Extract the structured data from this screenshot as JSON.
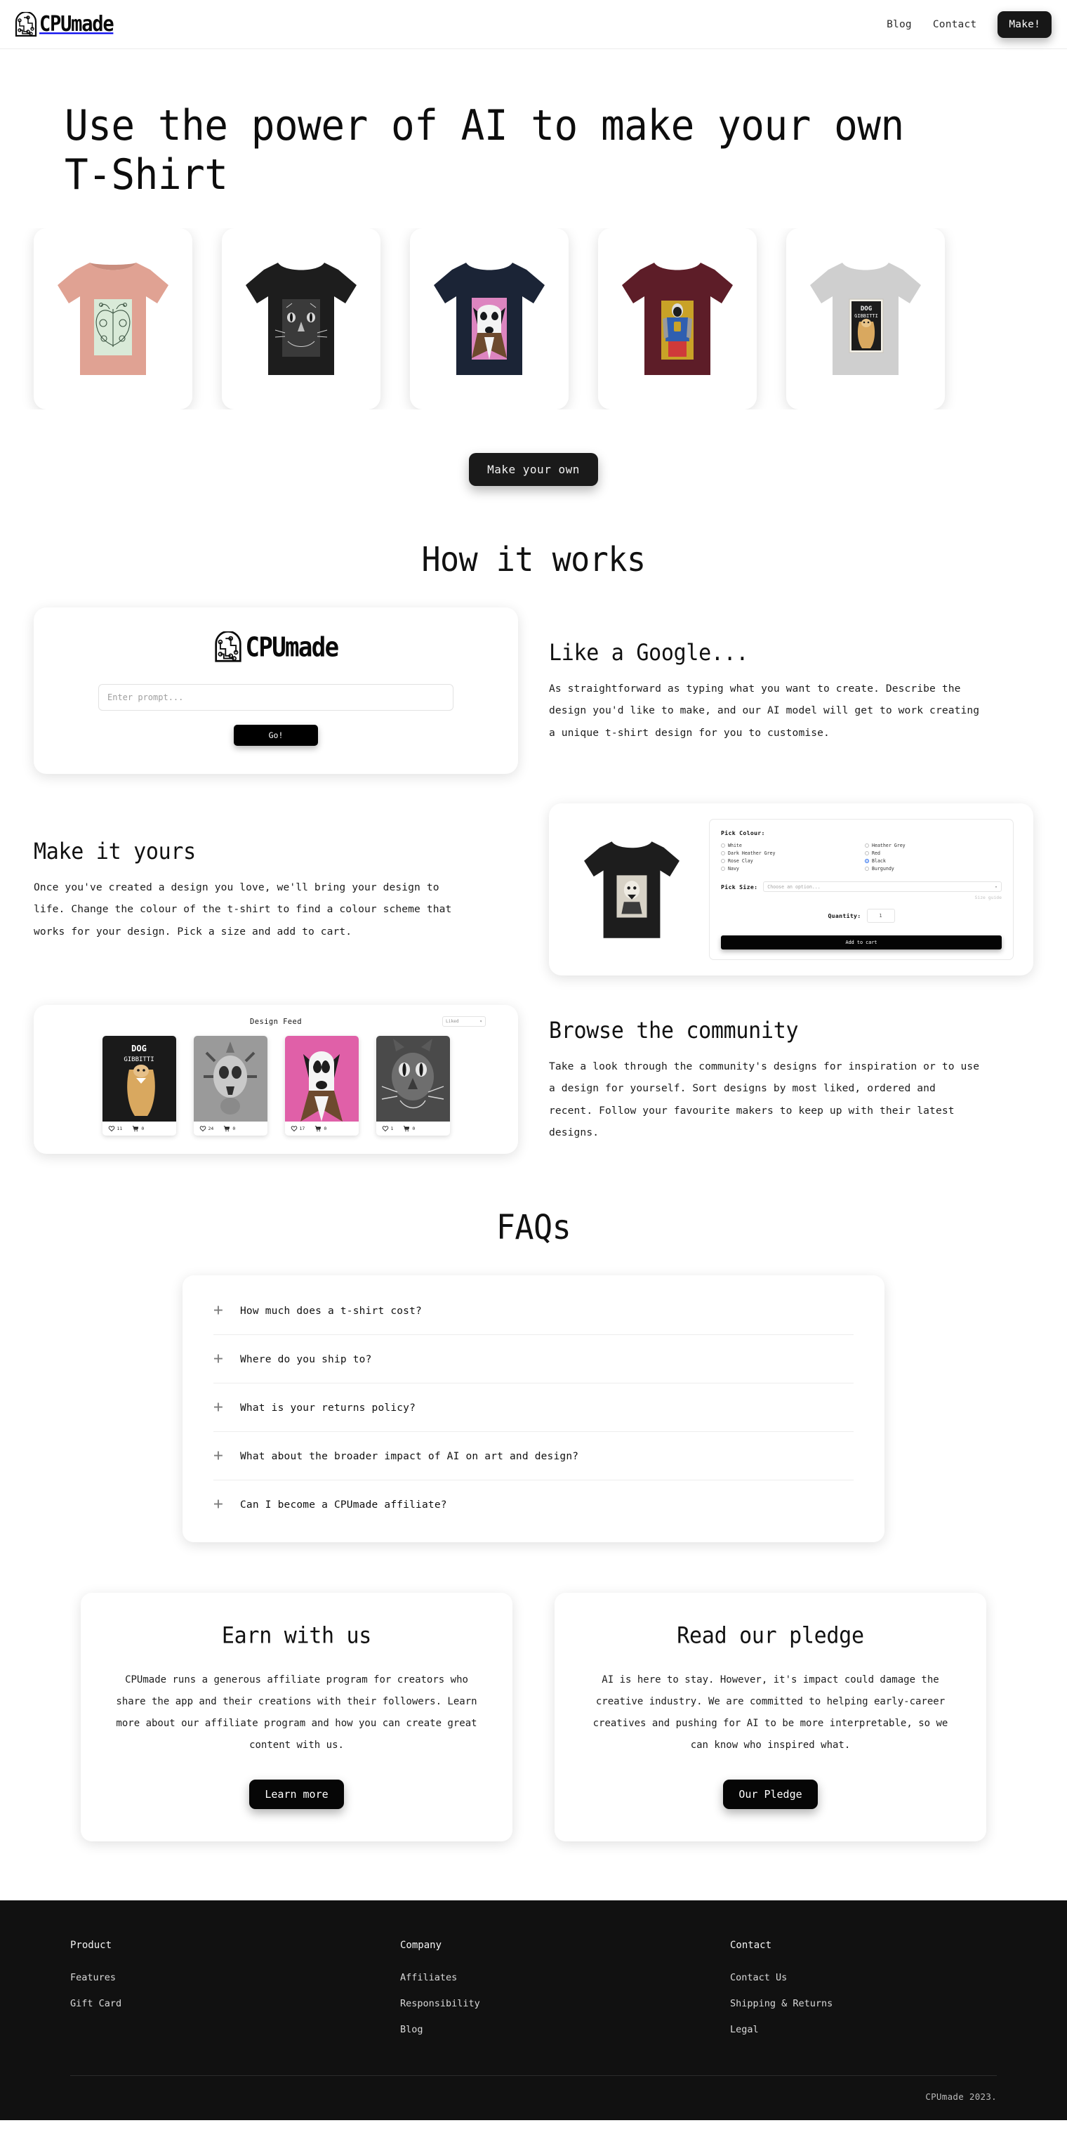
{
  "brand": {
    "name": "CPUmade",
    "logo_icon": "cpu-brain-icon"
  },
  "header": {
    "nav": [
      {
        "label": "Blog"
      },
      {
        "label": "Contact"
      }
    ],
    "cta_label": "Make!"
  },
  "hero": {
    "heading": "Use the power of AI to make your own T-Shirt",
    "cta_label": "Make your own",
    "shirts": [
      {
        "name": "Butterfly tee",
        "shirt_color": "#e0a293",
        "art_bg": "#d9ead8",
        "art": "butterfly"
      },
      {
        "name": "Cat tee",
        "shirt_color": "#1d1d1d",
        "art_bg": "#3a3a3a",
        "art": "cat"
      },
      {
        "name": "Dog tee",
        "shirt_color": "#1b2436",
        "art_bg": "#dd85c0",
        "art": "dog"
      },
      {
        "name": "Figure tee",
        "shirt_color": "#5d1d28",
        "art_bg": "#c9a227",
        "art": "figure"
      },
      {
        "name": "Poster tee",
        "shirt_color": "#cfcfcf",
        "art_bg": "#efe7d5",
        "art": "poster"
      }
    ]
  },
  "how_it_works": {
    "title": "How it works",
    "steps": [
      {
        "heading": "Like a Google...",
        "body": "As straightforward as typing what you want to create. Describe the design you'd like to make, and our AI model will get to work creating a unique t-shirt design for you to customise."
      },
      {
        "heading": "Make it yours",
        "body": "Once you've created a design you love, we'll bring your design to life. Change the colour of the t-shirt to find a colour scheme that works for your design. Pick a size and add to cart."
      },
      {
        "heading": "Browse the community",
        "body": "Take a look through the community's designs for inspiration or to use a design for yourself. Sort designs by most liked, ordered and recent. Follow your favourite makers to keep up with their latest designs."
      }
    ]
  },
  "prompt_card": {
    "placeholder": "Enter prompt...",
    "value": "",
    "go_label": "Go!"
  },
  "customizer": {
    "colour_label": "Pick Colour:",
    "colours": [
      {
        "label": "White",
        "selected": false
      },
      {
        "label": "Heather Grey",
        "selected": false
      },
      {
        "label": "Dark Heather Grey",
        "selected": false
      },
      {
        "label": "Red",
        "selected": false
      },
      {
        "label": "Rose Clay",
        "selected": false
      },
      {
        "label": "Black",
        "selected": true
      },
      {
        "label": "Navy",
        "selected": false
      },
      {
        "label": "Burgundy",
        "selected": false
      }
    ],
    "size_label": "Pick Size:",
    "size_placeholder": "Choose an option...",
    "size_guide_label": "Size guide",
    "quantity_label": "Quantity:",
    "quantity_value": "1",
    "add_to_cart_label": "Add to cart"
  },
  "design_feed": {
    "title": "Design Feed",
    "sort_value": "Liked",
    "cards": [
      {
        "name": "Dog Gibbitti poster",
        "likes": "11",
        "orders": "0",
        "art": "poster"
      },
      {
        "name": "Skull crown",
        "likes": "24",
        "orders": "0",
        "art": "skull"
      },
      {
        "name": "Collie dog",
        "likes": "17",
        "orders": "0",
        "art": "dog"
      },
      {
        "name": "Cat face",
        "likes": "1",
        "orders": "0",
        "art": "cat"
      }
    ]
  },
  "faqs": {
    "title": "FAQs",
    "items": [
      {
        "question": "How much does a t-shirt cost?"
      },
      {
        "question": "Where do you ship to?"
      },
      {
        "question": "What is your returns policy?"
      },
      {
        "question": "What about the broader impact of AI on art and design?"
      },
      {
        "question": "Can I become a CPUmade affiliate?"
      }
    ]
  },
  "bottom_cards": [
    {
      "heading": "Earn with us",
      "body": "CPUmade runs a generous affiliate program for creators who share the app and their creations with their followers. Learn more about our affiliate program and how you can create great content with us.",
      "button": "Learn more"
    },
    {
      "heading": "Read our pledge",
      "body": "AI is here to stay. However, it's impact could damage the creative industry. We are committed to helping early-career creatives and pushing for AI to be more interpretable, so we can know who inspired what.",
      "button": "Our Pledge"
    }
  ],
  "footer": {
    "columns": [
      {
        "title": "Product",
        "links": [
          {
            "label": "Features"
          },
          {
            "label": "Gift Card"
          }
        ]
      },
      {
        "title": "Company",
        "links": [
          {
            "label": "Affiliates"
          },
          {
            "label": "Responsibility"
          },
          {
            "label": "Blog"
          }
        ]
      },
      {
        "title": "Contact",
        "links": [
          {
            "label": "Contact Us"
          },
          {
            "label": "Shipping & Returns"
          },
          {
            "label": "Legal"
          }
        ]
      }
    ],
    "copyright": "CPUmade 2023."
  }
}
